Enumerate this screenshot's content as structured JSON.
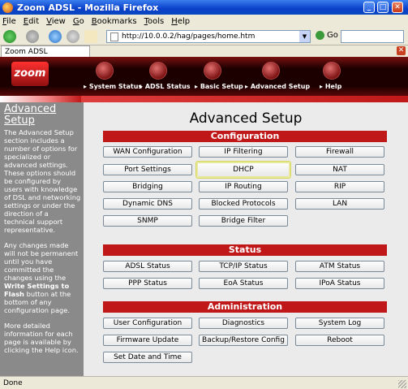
{
  "window": {
    "title": "Zoom ADSL - Mozilla Firefox"
  },
  "menu": [
    "File",
    "Edit",
    "View",
    "Go",
    "Bookmarks",
    "Tools",
    "Help"
  ],
  "menu_accel": [
    "F",
    "E",
    "V",
    "G",
    "B",
    "T",
    "H"
  ],
  "nav": {
    "url": "http://10.0.0.2/hag/pages/home.htm",
    "go_label": "Go"
  },
  "tab": {
    "title": "Zoom ADSL"
  },
  "header": {
    "logo": "zoom",
    "items": [
      "System Status",
      "ADSL Status",
      "Basic Setup",
      "Advanced Setup",
      "Help"
    ]
  },
  "sidebar": {
    "title": "Advanced Setup",
    "p1": "The Advanced Setup section includes a number of options for specialized or advanced settings. These options should be configured by users with knowledge of DSL and networking settings or under the direction of a technical support representative.",
    "p2a": "Any changes made will not be permanent until you have committed the changes using the ",
    "p2b": "Write Settings to Flash",
    "p2c": " button at the bottom of any configuration page.",
    "p3": "More detailed information for each page is available by clicking the Help icon."
  },
  "main": {
    "title": "Advanced Setup",
    "sections": [
      {
        "label": "Configuration"
      },
      {
        "label": "Status"
      },
      {
        "label": "Administration"
      }
    ],
    "config_buttons": [
      "WAN Configuration",
      "IP Filtering",
      "Firewall",
      "Port Settings",
      "DHCP",
      "NAT",
      "Bridging",
      "IP Routing",
      "RIP",
      "Dynamic DNS",
      "Blocked Protocols",
      "LAN",
      "SNMP",
      "Bridge Filter"
    ],
    "status_buttons": [
      "ADSL Status",
      "TCP/IP Status",
      "ATM Status",
      "PPP Status",
      "EoA Status",
      "IPoA Status"
    ],
    "admin_buttons": [
      "User Configuration",
      "Diagnostics",
      "System Log",
      "Firmware Update",
      "Backup/Restore Config",
      "Reboot",
      "Set Date and Time"
    ]
  },
  "statusbar": {
    "text": "Done"
  },
  "colors": {
    "accent": "#c01818",
    "sidebar": "#8a8a8a"
  }
}
